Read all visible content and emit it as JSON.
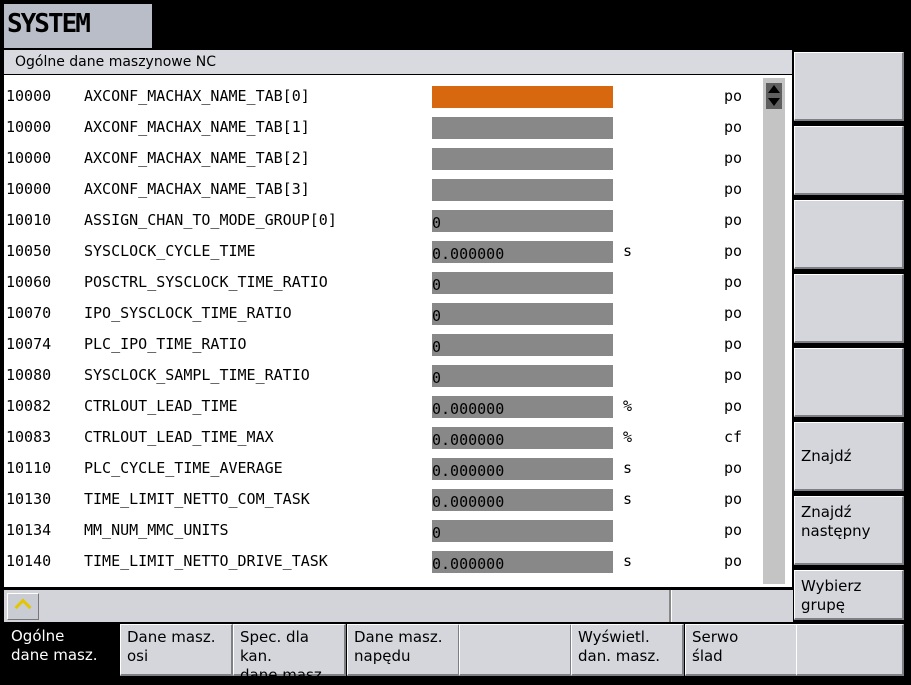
{
  "mode": {
    "label": "SYSTEM"
  },
  "panel": {
    "title": "Ogólne dane maszynowe NC"
  },
  "params": [
    {
      "id": "10000",
      "name": "AXCONF_MACHAX_NAME_TAB[0]",
      "value": "",
      "unit": "",
      "effect": "po",
      "active": true
    },
    {
      "id": "10000",
      "name": "AXCONF_MACHAX_NAME_TAB[1]",
      "value": "",
      "unit": "",
      "effect": "po"
    },
    {
      "id": "10000",
      "name": "AXCONF_MACHAX_NAME_TAB[2]",
      "value": "",
      "unit": "",
      "effect": "po"
    },
    {
      "id": "10000",
      "name": "AXCONF_MACHAX_NAME_TAB[3]",
      "value": "",
      "unit": "",
      "effect": "po"
    },
    {
      "id": "10010",
      "name": "ASSIGN_CHAN_TO_MODE_GROUP[0]",
      "value": "0",
      "unit": "",
      "effect": "po"
    },
    {
      "id": "10050",
      "name": "SYSCLOCK_CYCLE_TIME",
      "value": "0.000000",
      "unit": "s",
      "effect": "po"
    },
    {
      "id": "10060",
      "name": "POSCTRL_SYSCLOCK_TIME_RATIO",
      "value": "0",
      "unit": "",
      "effect": "po"
    },
    {
      "id": "10070",
      "name": "IPO_SYSCLOCK_TIME_RATIO",
      "value": "0",
      "unit": "",
      "effect": "po"
    },
    {
      "id": "10074",
      "name": "PLC_IPO_TIME_RATIO",
      "value": "0",
      "unit": "",
      "effect": "po"
    },
    {
      "id": "10080",
      "name": "SYSCLOCK_SAMPL_TIME_RATIO",
      "value": "0",
      "unit": "",
      "effect": "po"
    },
    {
      "id": "10082",
      "name": "CTRLOUT_LEAD_TIME",
      "value": "0.000000",
      "unit": "%",
      "effect": "po"
    },
    {
      "id": "10083",
      "name": "CTRLOUT_LEAD_TIME_MAX",
      "value": "0.000000",
      "unit": "%",
      "effect": "cf"
    },
    {
      "id": "10110",
      "name": "PLC_CYCLE_TIME_AVERAGE",
      "value": "0.000000",
      "unit": "s",
      "effect": "po"
    },
    {
      "id": "10130",
      "name": "TIME_LIMIT_NETTO_COM_TASK",
      "value": "0.000000",
      "unit": "s",
      "effect": "po"
    },
    {
      "id": "10134",
      "name": "MM_NUM_MMC_UNITS",
      "value": "0",
      "unit": "",
      "effect": "po"
    },
    {
      "id": "10140",
      "name": "TIME_LIMIT_NETTO_DRIVE_TASK",
      "value": "0.000000",
      "unit": "s",
      "effect": "po"
    }
  ],
  "vertical_softkeys": [
    {
      "label": ""
    },
    {
      "label": ""
    },
    {
      "label": ""
    },
    {
      "label": ""
    },
    {
      "label": ""
    },
    {
      "label": "Znajdź"
    },
    {
      "label": "Znajdź\nnastępny"
    },
    {
      "label": "Wybierz\ngrupę"
    }
  ],
  "horizontal_softkeys": [
    {
      "label": "Ogólne\ndane masz.",
      "active": true
    },
    {
      "label": "Dane masz.\nosi"
    },
    {
      "label": "Spec. dla kan.\ndane masz."
    },
    {
      "label": "Dane masz.\nnapędu"
    },
    {
      "label": ""
    },
    {
      "label": "Wyświetl.\ndan. masz."
    },
    {
      "label": "Serwo\nślad"
    },
    {
      "label": ""
    }
  ],
  "colors": {
    "active_value": "#d7680f",
    "value_field": "#888888",
    "recall_chevron": "#e3c600"
  },
  "icons": {
    "recall": "recall-chevron-up-icon",
    "scroll": "scroll-thumb-icon"
  }
}
